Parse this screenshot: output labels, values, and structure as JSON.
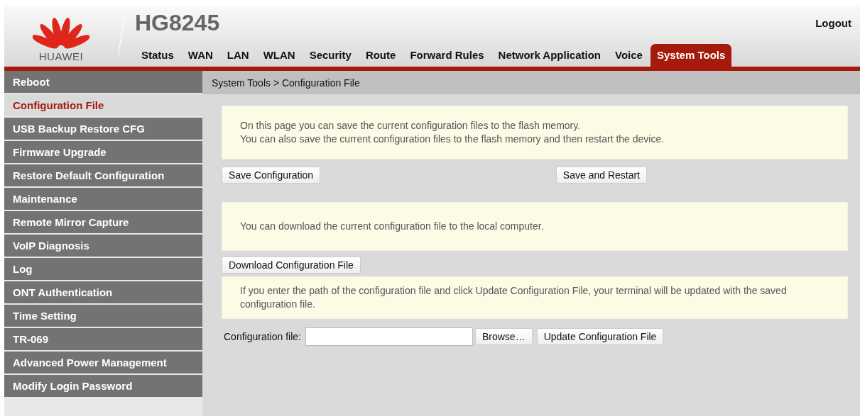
{
  "brand": {
    "logo_text": "HUAWEI",
    "model": "HG8245"
  },
  "logout": "Logout",
  "nav": [
    {
      "label": "Status",
      "selected": false
    },
    {
      "label": "WAN",
      "selected": false
    },
    {
      "label": "LAN",
      "selected": false
    },
    {
      "label": "WLAN",
      "selected": false
    },
    {
      "label": "Security",
      "selected": false
    },
    {
      "label": "Route",
      "selected": false
    },
    {
      "label": "Forward Rules",
      "selected": false
    },
    {
      "label": "Network Application",
      "selected": false
    },
    {
      "label": "Voice",
      "selected": false
    },
    {
      "label": "System Tools",
      "selected": true
    }
  ],
  "sidebar": {
    "items": [
      {
        "label": "Reboot",
        "selected": false
      },
      {
        "label": "Configuration File",
        "selected": true
      },
      {
        "label": "USB Backup Restore CFG",
        "selected": false
      },
      {
        "label": "Firmware Upgrade",
        "selected": false
      },
      {
        "label": "Restore Default Configuration",
        "selected": false
      },
      {
        "label": "Maintenance",
        "selected": false
      },
      {
        "label": "Remote Mirror Capture",
        "selected": false
      },
      {
        "label": "VoIP Diagnosis",
        "selected": false
      },
      {
        "label": "Log",
        "selected": false
      },
      {
        "label": "ONT Authentication",
        "selected": false
      },
      {
        "label": "Time Setting",
        "selected": false
      },
      {
        "label": "TR-069",
        "selected": false
      },
      {
        "label": "Advanced Power Management",
        "selected": false
      },
      {
        "label": "Modify Login Password",
        "selected": false
      }
    ]
  },
  "breadcrumb": "System Tools > Configuration File",
  "sections": [
    {
      "notes": [
        "On this page you can save the current configuration files to the flash memory.",
        "You can also save the current configuration files to the flash memory and then restart the device."
      ],
      "buttons": [
        "Save Configuration",
        "Save and Restart"
      ]
    },
    {
      "notes": [
        "You can download the current configuration file to the local computer."
      ],
      "buttons": [
        "Download Configuration File"
      ]
    },
    {
      "notes": [
        "If you enter the path of the configuration file and click Update Configuration File, your terminal will be updated with the saved configuration file."
      ],
      "file_label": "Configuration file:",
      "browse": "Browse…",
      "buttons": [
        "Update Configuration File"
      ]
    }
  ]
}
